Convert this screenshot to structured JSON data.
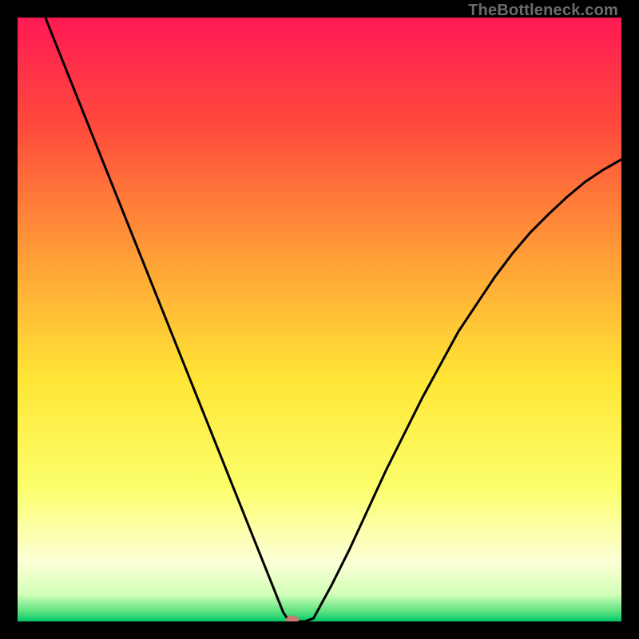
{
  "watermark": "TheBottleneck.com",
  "chart_data": {
    "type": "line",
    "title": "",
    "xlabel": "",
    "ylabel": "",
    "xlim": [
      0,
      100
    ],
    "ylim": [
      0,
      100
    ],
    "grid": false,
    "legend": false,
    "series": [
      {
        "name": "bottleneck-curve",
        "x": [
          0,
          2,
          5,
          8,
          11,
          14,
          17,
          20,
          23,
          26,
          29,
          32,
          35,
          37,
          39,
          40,
          41,
          42,
          43,
          44,
          45,
          46,
          47.5,
          49,
          52,
          55,
          58,
          61,
          64,
          67,
          70,
          73,
          76,
          79,
          82,
          85,
          88,
          91,
          94,
          97,
          100
        ],
        "y": [
          114,
          107,
          99,
          91.5,
          84,
          76.5,
          69,
          61.5,
          54,
          46.5,
          39,
          31.5,
          24,
          19,
          14,
          11.5,
          9,
          6.5,
          4,
          1.5,
          0,
          0,
          0,
          0.5,
          6,
          12,
          18.5,
          25,
          31,
          37,
          42.5,
          48,
          52.5,
          57,
          61,
          64.5,
          67.5,
          70.3,
          72.8,
          74.8,
          76.5
        ]
      }
    ],
    "marker": {
      "name": "optimal-point",
      "x": 45.5,
      "y": 0,
      "color": "#c97a76"
    },
    "gradient_stops": [
      {
        "offset": 0.0,
        "color": "#ff1a54"
      },
      {
        "offset": 0.18,
        "color": "#ff4a3c"
      },
      {
        "offset": 0.4,
        "color": "#ffa037"
      },
      {
        "offset": 0.6,
        "color": "#ffe636"
      },
      {
        "offset": 0.78,
        "color": "#fbff6c"
      },
      {
        "offset": 0.9,
        "color": "#fdffd6"
      },
      {
        "offset": 0.955,
        "color": "#d4ffb9"
      },
      {
        "offset": 0.985,
        "color": "#55e07e"
      },
      {
        "offset": 1.0,
        "color": "#00c86a"
      }
    ]
  }
}
